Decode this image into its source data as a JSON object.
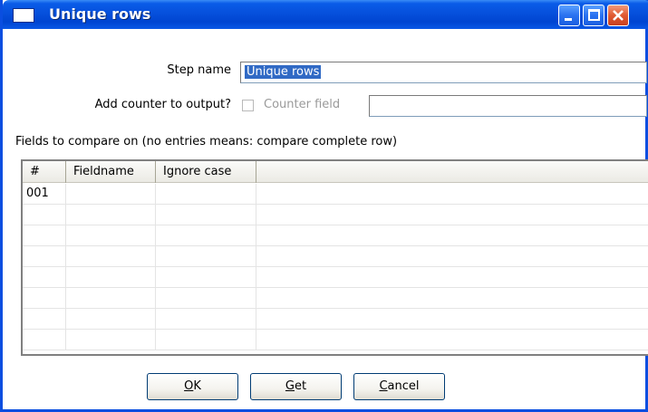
{
  "window": {
    "title": "Unique rows"
  },
  "form": {
    "step_name_label": "Step name",
    "step_name_value": "Unique rows",
    "add_counter_label": "Add counter to output?",
    "counter_field_label": "Counter field",
    "counter_field_value": "",
    "fields_section_label": "Fields to compare on (no entries means: compare complete row)"
  },
  "table": {
    "columns": [
      "#",
      "Fieldname",
      "Ignore case"
    ],
    "rows": [
      [
        "001",
        "",
        ""
      ],
      [
        "",
        "",
        ""
      ],
      [
        "",
        "",
        ""
      ],
      [
        "",
        "",
        ""
      ],
      [
        "",
        "",
        ""
      ],
      [
        "",
        "",
        ""
      ],
      [
        "",
        "",
        ""
      ],
      [
        "",
        "",
        ""
      ]
    ]
  },
  "buttons": {
    "ok_mnemonic": "O",
    "ok_rest": "K",
    "get_mnemonic": "G",
    "get_rest": "et",
    "cancel_mnemonic": "C",
    "cancel_rest": "ancel"
  },
  "colors": {
    "titlebar": "#0650dc",
    "selection": "#316ac5",
    "close_button": "#e05a32"
  }
}
